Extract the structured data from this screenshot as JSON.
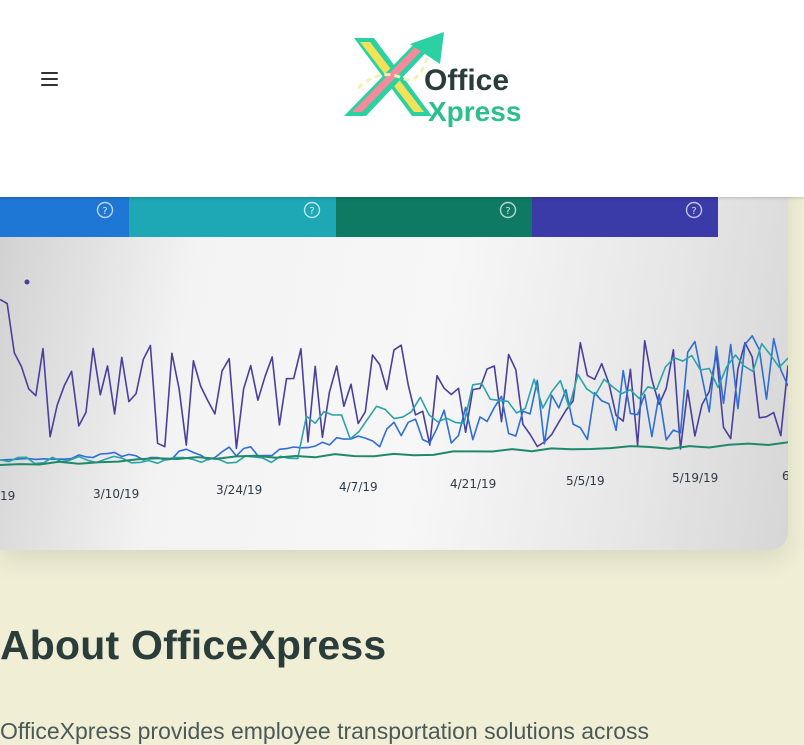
{
  "header": {
    "menu_icon": "hamburger-menu-icon",
    "logo": {
      "word1": "Office",
      "word2": "Xpress",
      "mark": "X"
    }
  },
  "hero": {
    "tiles": [
      {
        "color": "#1e77d4",
        "icon": "help-circle-icon"
      },
      {
        "color": "#1ea7b4",
        "icon": "help-circle-icon"
      },
      {
        "color": "#0e7a63",
        "icon": "help-circle-icon"
      },
      {
        "color": "#3a3aa8",
        "icon": "help-circle-icon"
      }
    ],
    "chart_data": {
      "type": "line",
      "x_ticks": [
        "19",
        "3/10/19",
        "3/24/19",
        "4/7/19",
        "4/21/19",
        "5/5/19",
        "5/19/19",
        "6"
      ],
      "series": [
        {
          "color": "#4a3f9c"
        },
        {
          "color": "#2e6ed6"
        },
        {
          "color": "#2aa3a9"
        },
        {
          "color": "#1f8a6a"
        }
      ]
    }
  },
  "about": {
    "heading": "About OfficeXpress",
    "intro": "OfficeXpress provides employee transportation solutions across"
  }
}
